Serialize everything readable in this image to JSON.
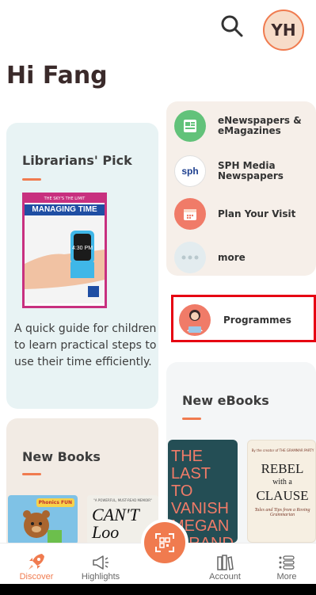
{
  "header": {
    "avatar_initials": "YH",
    "greeting": "Hi Fang"
  },
  "librarians_pick": {
    "title": "Librarians' Pick",
    "book": {
      "top_text": "THE SKY'S THE LIMIT",
      "banner": "MANAGING TIME",
      "watch_time": "4:30 PM"
    },
    "description": "A quick guide for children to learn practical steps to use their time efficiently."
  },
  "services": [
    {
      "label": "eNewspapers & eMagazines",
      "icon": "newspaper-icon",
      "color": "#62c27a"
    },
    {
      "label": "SPH Media Newspapers",
      "icon": "sph-logo-icon",
      "color": "#ffffff"
    },
    {
      "label": "Plan Your Visit",
      "icon": "calendar-icon",
      "color": "#f07b68"
    },
    {
      "label": "more",
      "icon": "more-dots-icon",
      "color": "#e6eef1"
    }
  ],
  "programmes": {
    "label": "Programmes"
  },
  "new_ebooks": {
    "title": "New eBooks",
    "books": [
      {
        "cover_text": "THE LAST TO VANISH MEGAN MIRANDA"
      },
      {
        "top_text": "By the creator of THE GRAMMAR PARTY",
        "title_line1": "REBEL",
        "title_line2": "with a",
        "title_line3": "CLAUSE",
        "subtitle": "Tales and Tips from a Roving Grammarian"
      }
    ]
  },
  "new_books": {
    "title": "New Books",
    "books": [
      {
        "badge": "Phonics FUN"
      },
      {
        "top_text": "\"A POWERFUL, MUST-READ MEMOIR\"",
        "title": "CAN'T Loo"
      }
    ]
  },
  "nav": {
    "discover": "Discover",
    "highlights": "Highlights",
    "account": "Account",
    "more": "More"
  },
  "colors": {
    "accent": "#f07b4f",
    "highlight_border": "#e60012"
  }
}
